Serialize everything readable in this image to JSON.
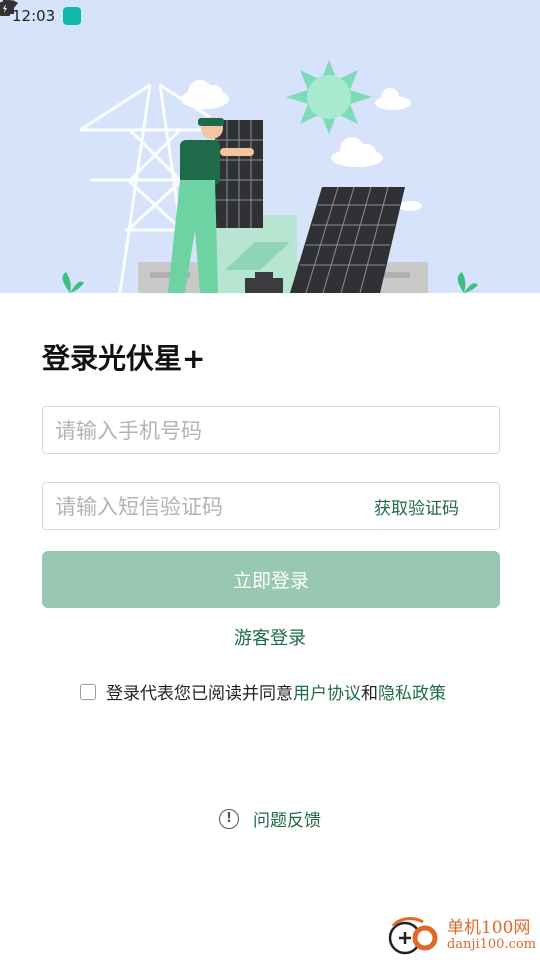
{
  "status_bar": {
    "time": "12:03"
  },
  "login": {
    "title": "登录光伏星+",
    "phone_placeholder": "请输入手机号码",
    "code_placeholder": "请输入短信验证码",
    "get_code_label": "获取验证码",
    "login_button": "立即登录",
    "guest_login": "游客登录",
    "agreement_prefix": "登录代表您已阅读并同意",
    "agreement_user": "用户协议",
    "agreement_and": "和",
    "agreement_privacy": "隐私政策",
    "feedback": "问题反馈"
  },
  "watermark": {
    "title": "单机100网",
    "url": "danji100.com"
  },
  "colors": {
    "accent": "#1f6b44",
    "button_disabled": "#98c8b2",
    "hero_bg": "#d6e3fb"
  }
}
